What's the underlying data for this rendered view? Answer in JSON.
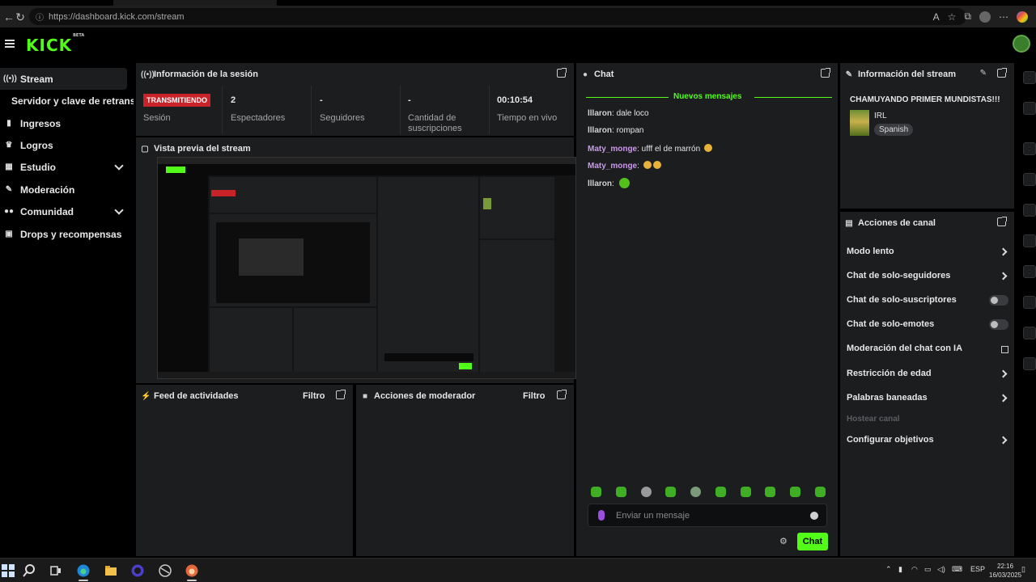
{
  "browser": {
    "url": "https://dashboard.kick.com/stream"
  },
  "header": {
    "logo": "KICK",
    "logo_badge": "BETA"
  },
  "sidebar": {
    "items": [
      {
        "label": "Stream",
        "icon": "radio-waves-icon"
      },
      {
        "label": "Servidor y clave de retransm",
        "icon": ""
      },
      {
        "label": "Ingresos",
        "icon": "bar-chart-icon"
      },
      {
        "label": "Logros",
        "icon": "trophy-icon"
      },
      {
        "label": "Estudio",
        "icon": "grid-icon"
      },
      {
        "label": "Moderación",
        "icon": "wrench-icon"
      },
      {
        "label": "Comunidad",
        "icon": "people-icon"
      },
      {
        "label": "Drops y recompensas",
        "icon": "gift-icon"
      }
    ]
  },
  "session": {
    "title": "Información de la sesión",
    "status_badge": "TRANSMITIENDO",
    "status_label": "Sesión",
    "viewers_value": "2",
    "viewers_label": "Espectadores",
    "followers_value": "-",
    "followers_label": "Seguidores",
    "subs_value": "-",
    "subs_label": "Cantidad de suscripciones",
    "live_value": "00:10:54",
    "live_label": "Tiempo en vivo"
  },
  "preview": {
    "title": "Vista previa del stream"
  },
  "activity": {
    "title": "Feed de actividades",
    "filter": "Filtro"
  },
  "mod_actions": {
    "title": "Acciones de moderador",
    "filter": "Filtro"
  },
  "chat": {
    "title": "Chat",
    "new_messages": "Nuevos mensajes",
    "messages": [
      {
        "user": "lllaron",
        "text": " dale loco"
      },
      {
        "user": "lllaron",
        "text": " rompan"
      },
      {
        "user": "Maty_monge",
        "text": " ufff el de marrón"
      },
      {
        "user": "Maty_monge",
        "text": ""
      },
      {
        "user": "lllaron",
        "text": ""
      }
    ],
    "placeholder": "Enviar un mensaje",
    "send_label": "Chat"
  },
  "stream_info": {
    "title": "Información del stream",
    "stream_title": "CHAMUYANDO PRIMER MUNDISTAS!!!",
    "category": "IRL",
    "language": "Spanish"
  },
  "channel_actions": {
    "title": "Acciones de canal",
    "items": [
      {
        "label": "Modo lento",
        "control": "chevron"
      },
      {
        "label": "Chat de solo-seguidores",
        "control": "chevron"
      },
      {
        "label": "Chat de solo-suscriptores",
        "control": "toggle"
      },
      {
        "label": "Chat de solo-emotes",
        "control": "toggle"
      },
      {
        "label": "Moderación del chat con IA",
        "control": "external"
      },
      {
        "label": "Restricción de edad",
        "control": "chevron"
      },
      {
        "label": "Palabras baneadas",
        "control": "chevron"
      },
      {
        "label": "Hostear canal",
        "control": "disabled"
      },
      {
        "label": "Configurar objetivos",
        "control": "chevron"
      }
    ]
  },
  "taskbar": {
    "language": "ESP",
    "time": "22:16",
    "date": "16/03/2025"
  },
  "colors": {
    "accent": "#53fc18",
    "live": "#c9232a",
    "panel": "#1b1d1f"
  }
}
